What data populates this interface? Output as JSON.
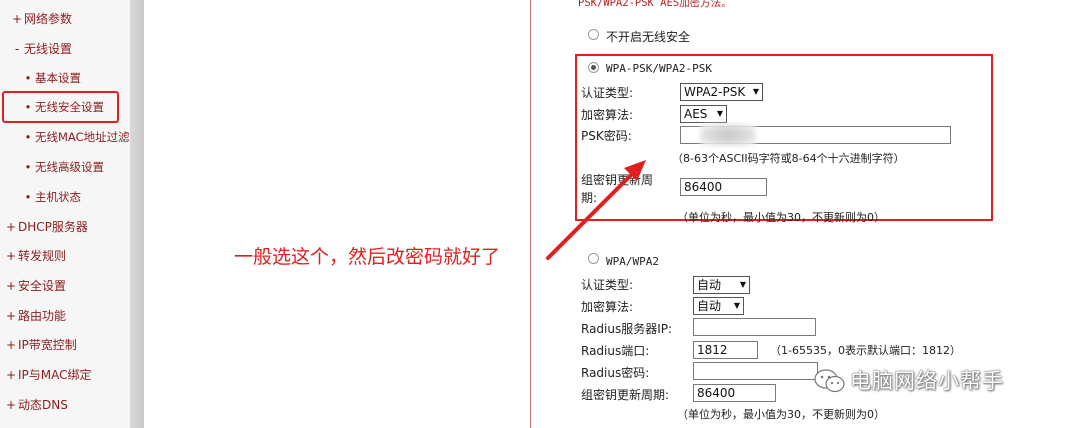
{
  "sidebar": {
    "items": [
      {
        "label": "网络参数",
        "bullet": "+",
        "level": 0
      },
      {
        "label": "无线设置",
        "bullet": "-",
        "level": 0
      },
      {
        "label": "基本设置",
        "bullet": "•",
        "level": 1
      },
      {
        "label": "无线安全设置",
        "bullet": "•",
        "level": 1,
        "active": true
      },
      {
        "label": "无线MAC地址过滤",
        "bullet": "•",
        "level": 1
      },
      {
        "label": "无线高级设置",
        "bullet": "•",
        "level": 1
      },
      {
        "label": "主机状态",
        "bullet": "•",
        "level": 1
      },
      {
        "label": "DHCP服务器",
        "bullet": "+",
        "level": 0
      },
      {
        "label": "转发规则",
        "bullet": "+",
        "level": 0
      },
      {
        "label": "安全设置",
        "bullet": "+",
        "level": 0
      },
      {
        "label": "路由功能",
        "bullet": "+",
        "level": 0
      },
      {
        "label": "IP带宽控制",
        "bullet": "+",
        "level": 0
      },
      {
        "label": "IP与MAC绑定",
        "bullet": "+",
        "level": 0
      },
      {
        "label": "动态DNS",
        "bullet": "+",
        "level": 0
      }
    ]
  },
  "form": {
    "top_note": "PSK/WPA2-PSK AES加密方法。",
    "no_security": {
      "label": "不开启无线安全",
      "selected": false
    },
    "wpa_psk": {
      "title": "WPA-PSK/WPA2-PSK",
      "selected": true,
      "auth_type_label": "认证类型:",
      "auth_type_value": "WPA2-PSK",
      "encryption_label": "加密算法:",
      "encryption_value": "AES",
      "psk_label": "PSK密码:",
      "psk_value": "",
      "psk_hint": "（8-63个ASCII码字符或8-64个十六进制字符）",
      "group_key_label_1": "组密钥更新周",
      "group_key_label_2": "期:",
      "group_key_value": "86400",
      "group_key_hint": "（单位为秒，最小值为30，不更新则为0）"
    },
    "wpa": {
      "title": "WPA/WPA2",
      "selected": false,
      "auth_type_label": "认证类型:",
      "auth_type_value": "自动",
      "encryption_label": "加密算法:",
      "encryption_value": "自动",
      "radius_ip_label": "Radius服务器IP:",
      "radius_ip_value": "",
      "radius_port_label": "Radius端口:",
      "radius_port_value": "1812",
      "radius_port_hint": "（1-65535，0表示默认端口：1812）",
      "radius_pwd_label": "Radius密码:",
      "radius_pwd_value": "",
      "group_key_label": "组密钥更新周期:",
      "group_key_value": "86400",
      "group_key_hint": "（单位为秒，最小值为30，不更新则为0）"
    }
  },
  "annotation": {
    "text": "一般选这个，然后改密码就好了",
    "color": "#e02020"
  },
  "watermark": {
    "text": "电脑网络小帮手",
    "icon": "wechat-icon"
  },
  "colors": {
    "highlight": "#e02020",
    "nav_text": "#8c1c1c"
  }
}
